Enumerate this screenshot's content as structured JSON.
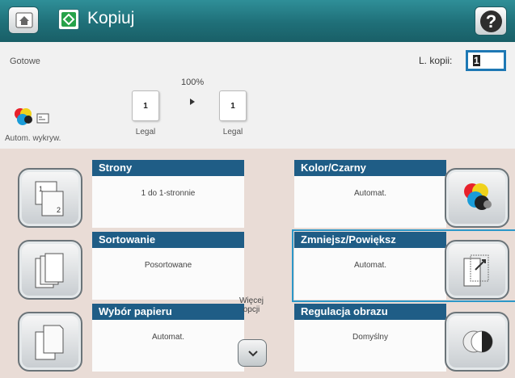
{
  "titlebar": {
    "title": "Kopiuj"
  },
  "status": {
    "text": "Gotowe",
    "copies_label": "L. kopii:",
    "copies_value": "1",
    "zoom": "100%",
    "source_page": "1",
    "source_label": "Legal",
    "output_page": "1",
    "output_label": "Legal",
    "detect_label": "Autom. wykryw."
  },
  "options": [
    {
      "title": "Strony",
      "value": "1 do 1-stronnie",
      "icon": "duplex-pages-icon"
    },
    {
      "title": "Kolor/Czarny",
      "value": "Automat.",
      "icon": "color-mode-icon"
    },
    {
      "title": "Sortowanie",
      "value": "Posortowane",
      "icon": "collate-icon"
    },
    {
      "title": "Zmniejsz/Powiększ",
      "value": "Automat.",
      "icon": "reduce-enlarge-icon"
    },
    {
      "title": "Wybór papieru",
      "value": "Automat.",
      "icon": "paper-select-icon"
    },
    {
      "title": "Regulacja obrazu",
      "value": "Domyślny",
      "icon": "image-adjust-icon"
    }
  ],
  "more_options": {
    "label": "Więcej opcji"
  },
  "colors": {
    "title_bar": "#1f6f78",
    "card_header": "#1f5d86",
    "selected_outline": "#2c97c8"
  }
}
